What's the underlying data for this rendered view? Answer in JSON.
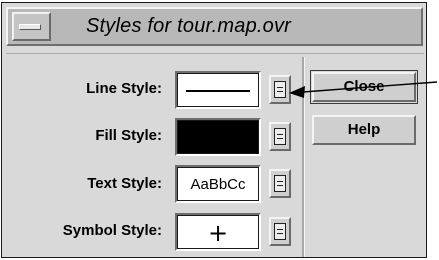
{
  "window": {
    "title": "Styles for tour.map.ovr"
  },
  "rows": [
    {
      "label": "Line Style:",
      "swatch": "line"
    },
    {
      "label": "Fill Style:",
      "swatch": "fill"
    },
    {
      "label": "Text Style:",
      "swatch": "text",
      "sample": "AaBbCc"
    },
    {
      "label": "Symbol Style:",
      "swatch": "symbol",
      "sample": "+"
    }
  ],
  "buttons": {
    "close": "Close",
    "help": "Help"
  },
  "icons": {
    "window_menu": "window-menu-icon",
    "option_menu": "option-menu-icon",
    "callout": "callout-arrow"
  },
  "colors": {
    "panel": "#d9d9d9",
    "titlebar": "#b8b8b8",
    "fill_swatch": "#000000"
  }
}
